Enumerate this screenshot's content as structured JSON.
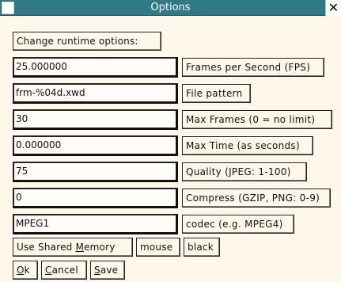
{
  "window": {
    "title": "Options",
    "close_glyph": "✕"
  },
  "header_button": "Change runtime options:",
  "rows": [
    {
      "value": "25.000000",
      "label": "Frames per Second (FPS)"
    },
    {
      "value": "frm-%04d.xwd",
      "label": "File pattern"
    },
    {
      "value": "30",
      "label": "Max Frames (0 = no limit)"
    },
    {
      "value": "0.000000",
      "label": "Max Time (as seconds)"
    },
    {
      "value": "75",
      "label": "Quality (JPEG: 1-100)"
    },
    {
      "value": "0",
      "label": "Compress (GZIP, PNG: 0-9)"
    },
    {
      "value": "MPEG1",
      "label": "codec (e.g. MPEG4)"
    }
  ],
  "toggles": {
    "shared_memory_prefix": "Use Shared ",
    "shared_memory_underlined": "M",
    "shared_memory_suffix": "emory",
    "mouse": "mouse",
    "black": "black"
  },
  "actions": {
    "ok_underlined": "O",
    "ok_rest": "k",
    "cancel_underlined": "C",
    "cancel_rest": "ancel",
    "save_underlined": "S",
    "save_rest": "ave"
  },
  "colors": {
    "titlebar": "#2f7a86",
    "background": "#fff7ea"
  }
}
